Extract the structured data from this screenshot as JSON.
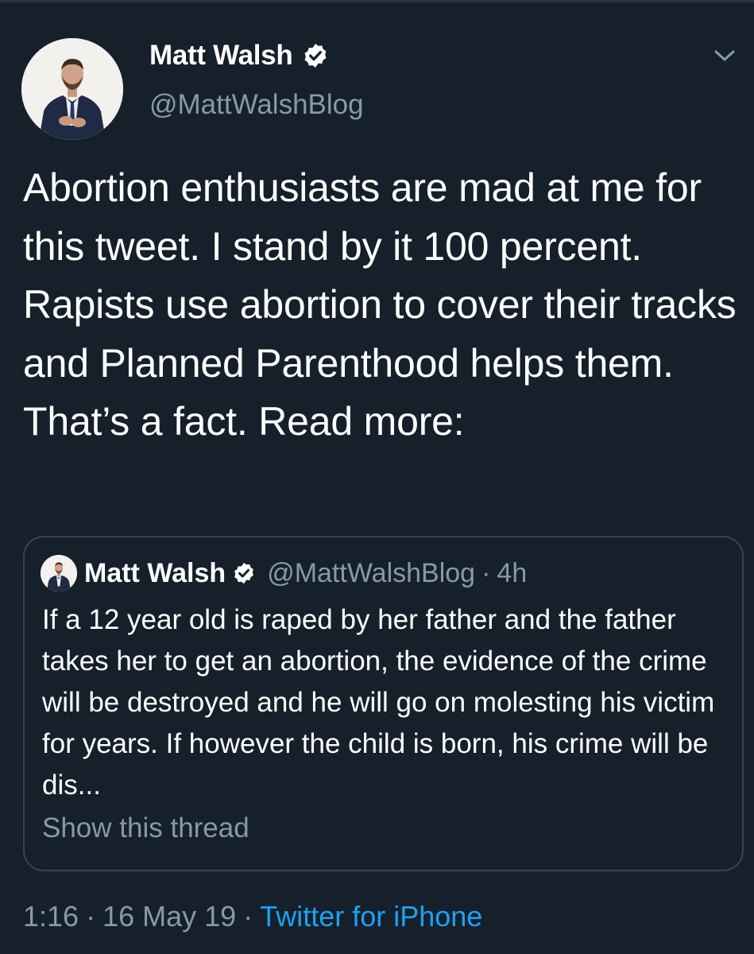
{
  "tweet": {
    "author": {
      "name": "Matt Walsh",
      "handle": "@MattWalshBlog"
    },
    "text": "Abortion enthusiasts are mad at me for this tweet. I stand by it 100 percent. Rapists use abortion to cover their tracks and Planned Parenthood helps them. That’s a fact. Read more:",
    "time": "1:16",
    "separator": "·",
    "date": "16 May 19",
    "source": "Twitter for iPhone"
  },
  "quoted": {
    "name": "Matt Walsh",
    "handle": "@MattWalshBlog",
    "separator": "·",
    "time": "4h",
    "text": "If a 12 year old is raped by her father and the father takes her to get an abortion, the evidence of the crime will be destroyed and he will go on molesting his victim for years. If however the child is born, his crime will be dis...",
    "show_thread": "Show this thread"
  },
  "icons": {
    "verified": "verified-badge-icon",
    "caret": "chevron-down-icon"
  },
  "colors": {
    "background": "#15202b",
    "text_primary": "#ffffff",
    "text_secondary": "#8899a6",
    "link": "#1da1f2",
    "card_border": "#38444d"
  }
}
